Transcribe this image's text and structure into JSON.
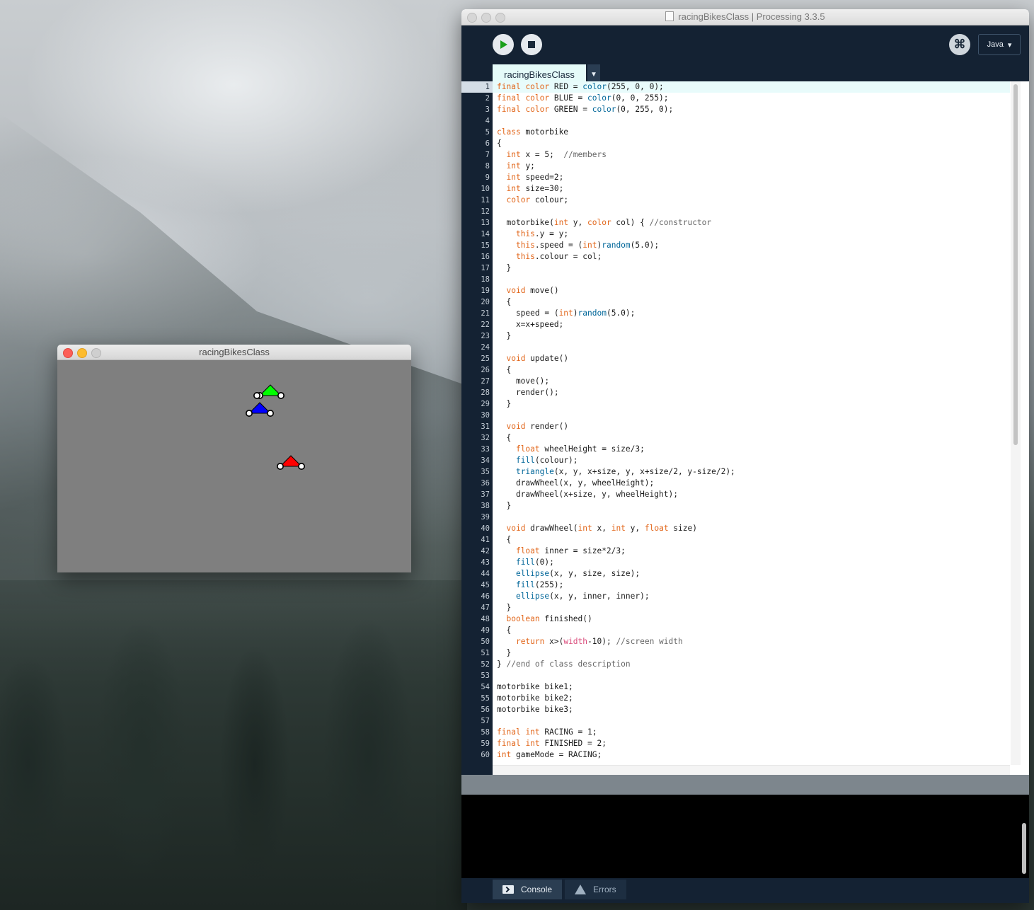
{
  "sketch": {
    "title": "racingBikesClass",
    "bikes": [
      {
        "name": "GREEN",
        "color": "#00ff00"
      },
      {
        "name": "BLUE",
        "color": "#0000ff"
      },
      {
        "name": "RED",
        "color": "#ff0000"
      }
    ]
  },
  "ide": {
    "title": "racingBikesClass | Processing 3.3.5",
    "mode_label": "Java",
    "tab_label": "racingBikesClass",
    "current_line": 1,
    "bottom_tabs": {
      "console": "Console",
      "errors": "Errors"
    }
  },
  "code_lines": [
    "final color RED = color(255, 0, 0);",
    "final color BLUE = color(0, 0, 255);",
    "final color GREEN = color(0, 255, 0);",
    "",
    "class motorbike",
    "{",
    "  int x = 5;  //members",
    "  int y;",
    "  int speed=2;",
    "  int size=30;",
    "  color colour;",
    "",
    "  motorbike(int y, color col) { //constructor",
    "    this.y = y;",
    "    this.speed = (int)random(5.0);",
    "    this.colour = col;",
    "  }",
    "",
    "  void move()",
    "  {",
    "    speed = (int)random(5.0);",
    "    x=x+speed;",
    "  }",
    "",
    "  void update()",
    "  {",
    "    move();",
    "    render();",
    "  }",
    "",
    "  void render()",
    "  {",
    "    float wheelHeight = size/3;",
    "    fill(colour);",
    "    triangle(x, y, x+size, y, x+size/2, y-size/2);",
    "    drawWheel(x, y, wheelHeight);",
    "    drawWheel(x+size, y, wheelHeight);",
    "  }",
    "",
    "  void drawWheel(int x, int y, float size)",
    "  {",
    "    float inner = size*2/3;",
    "    fill(0);",
    "    ellipse(x, y, size, size);",
    "    fill(255);",
    "    ellipse(x, y, inner, inner);",
    "  }",
    "  boolean finished()",
    "  {",
    "    return x>(width-10); //screen width",
    "  }",
    "} //end of class description",
    "",
    "motorbike bike1;",
    "motorbike bike2;",
    "motorbike bike3;",
    "",
    "final int RACING = 1;",
    "final int FINISHED = 2;",
    "int gameMode = RACING;"
  ]
}
